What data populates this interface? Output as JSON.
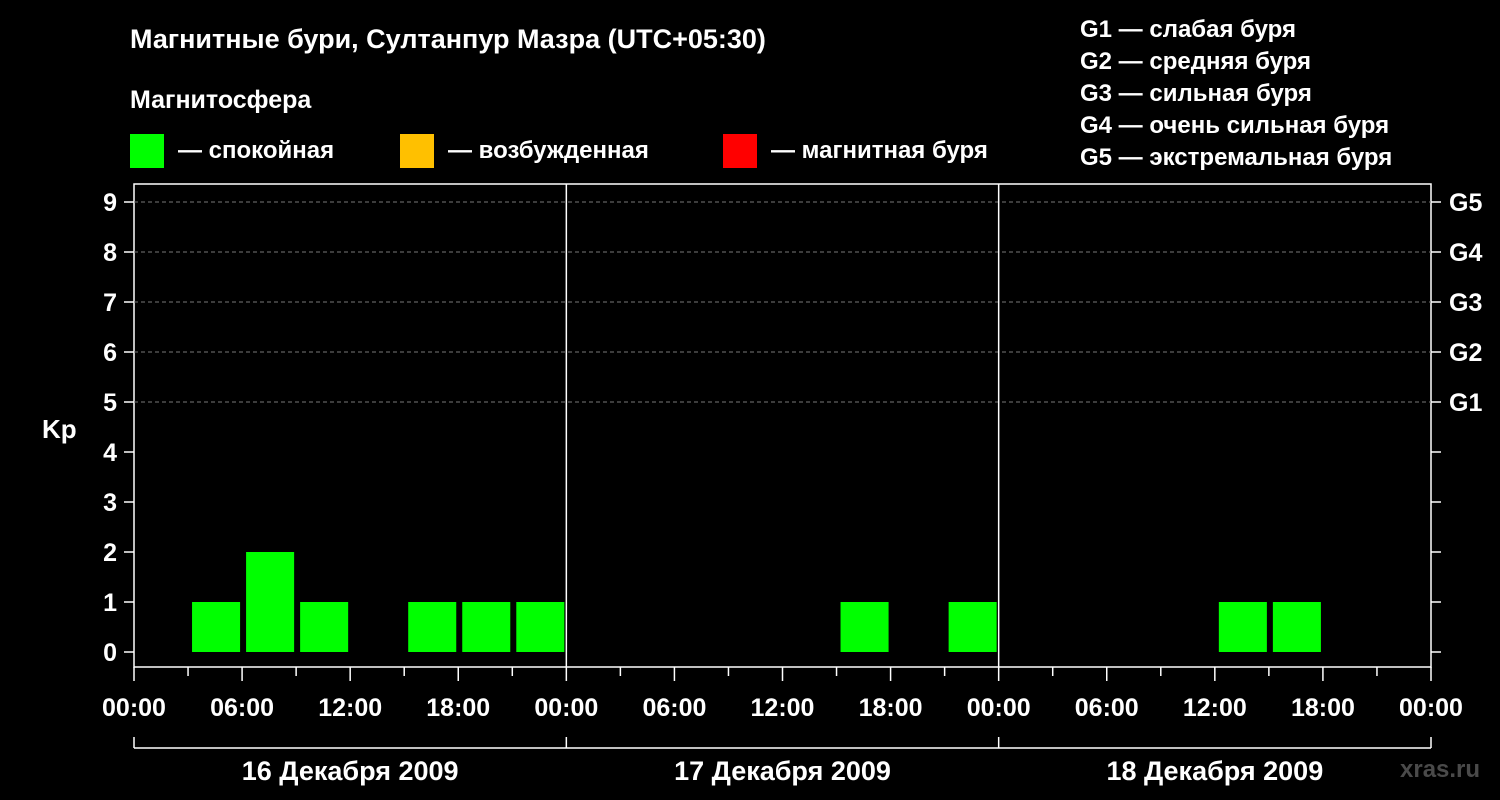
{
  "title": "Магнитные бури, Султанпур Мазра (UTC+05:30)",
  "subtitle": "Магнитосфера",
  "legend": [
    {
      "label": "— спокойная",
      "color": "#00ff00"
    },
    {
      "label": "— возбужденная",
      "color": "#ffc000"
    },
    {
      "label": "— магнитная буря",
      "color": "#ff0000"
    }
  ],
  "storm_legend": [
    "G1 — слабая буря",
    "G2 — средняя буря",
    "G3 — сильная буря",
    "G4 — очень сильная буря",
    "G5 — экстремальная буря"
  ],
  "watermark": "xras.ru",
  "chart_data": {
    "type": "bar",
    "ylabel": "Kp",
    "xlabel": "",
    "ylim": [
      0,
      9
    ],
    "y_ticks": [
      0,
      1,
      2,
      3,
      4,
      5,
      6,
      7,
      8,
      9
    ],
    "right_axis_labels": [
      {
        "kp": 5,
        "label": "G1"
      },
      {
        "kp": 6,
        "label": "G2"
      },
      {
        "kp": 7,
        "label": "G3"
      },
      {
        "kp": 8,
        "label": "G4"
      },
      {
        "kp": 9,
        "label": "G5"
      }
    ],
    "grid": "dashed horizontal at Kp 5-9",
    "interval_hours": 3,
    "time_tick_labels": [
      "00:00",
      "06:00",
      "12:00",
      "18:00",
      "00:00",
      "06:00",
      "12:00",
      "18:00",
      "00:00",
      "06:00",
      "12:00",
      "18:00",
      "00:00"
    ],
    "days": [
      {
        "label": "16 Декабря 2009",
        "values": [
          0,
          1,
          2,
          1,
          0,
          1,
          1,
          1
        ]
      },
      {
        "label": "17 Декабря 2009",
        "values": [
          0,
          0,
          0,
          0,
          0,
          1,
          0,
          1
        ]
      },
      {
        "label": "18 Декабря 2009",
        "values": [
          0,
          0,
          0,
          0,
          1,
          1,
          0,
          0
        ]
      }
    ],
    "bar_color": "#00ff00"
  }
}
